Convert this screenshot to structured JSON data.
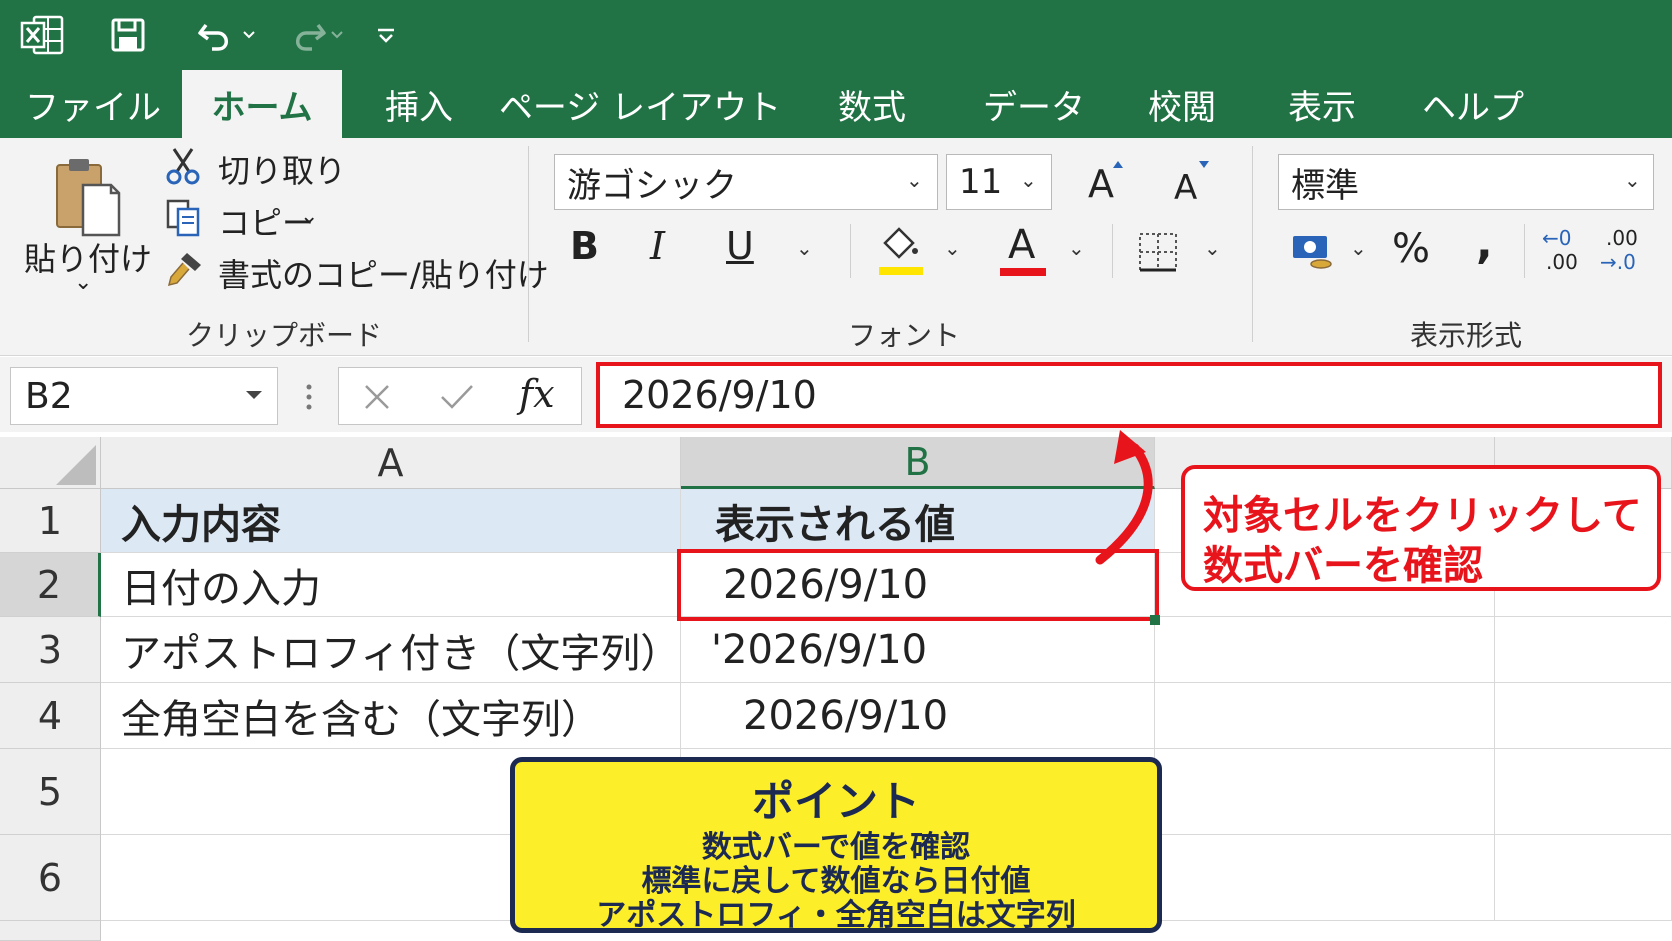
{
  "window": {
    "qa_icons": [
      "excel-logo-icon",
      "save-icon",
      "undo-icon",
      "redo-icon",
      "customize-qat-icon"
    ]
  },
  "tabs": [
    "ファイル",
    "ホーム",
    "挿入",
    "ページ レイアウト",
    "数式",
    "データ",
    "校閲",
    "表示",
    "ヘルプ"
  ],
  "ribbon": {
    "clipboard": {
      "paste_label": "貼り付け",
      "cut_label": "切り取り",
      "copy_label": "コピー",
      "format_painter_label": "書式のコピー/貼り付け",
      "group_label": "クリップボード"
    },
    "font": {
      "font_name": "游ゴシック",
      "font_size": "11",
      "grow_label": "A",
      "shrink_label": "A",
      "bold_label": "B",
      "italic_label": "I",
      "underline_label": "U",
      "font_color_label": "A",
      "group_label": "フォント"
    },
    "number": {
      "format_value": "標準",
      "percent_label": "%",
      "comma_label": ",",
      "inc_decimal_top": "←0",
      "inc_decimal_bottom": ".00",
      "dec_decimal_top": ".00",
      "dec_decimal_bottom": "→.0",
      "group_label": "表示形式"
    }
  },
  "formula_bar": {
    "name_box": "B2",
    "fx_label": "fx",
    "formula": "2026/9/10"
  },
  "sheet": {
    "columns": [
      "A",
      "B"
    ],
    "rows": [
      "1",
      "2",
      "3",
      "4",
      "5",
      "6"
    ],
    "cells": [
      [
        "入力内容",
        "表示される値"
      ],
      [
        "日付の入力",
        "2026/9/10"
      ],
      [
        "アポストロフィ付き（文字列）",
        "'2026/9/10"
      ],
      [
        "全角空白を含む（文字列）",
        "2026/9/10"
      ]
    ]
  },
  "callout": {
    "line1": "対象セルをクリックして",
    "line2": "数式バーを確認"
  },
  "point_box": {
    "title": "ポイント",
    "lines": [
      "数式バーで値を確認",
      "標準に戻して数値なら日付値",
      "アポストロフィ・全角空白は文字列"
    ]
  },
  "colors": {
    "excel_green": "#217346",
    "highlight_red": "#e8141c",
    "point_yellow": "#fdee2a",
    "point_navy": "#1c2a52"
  }
}
